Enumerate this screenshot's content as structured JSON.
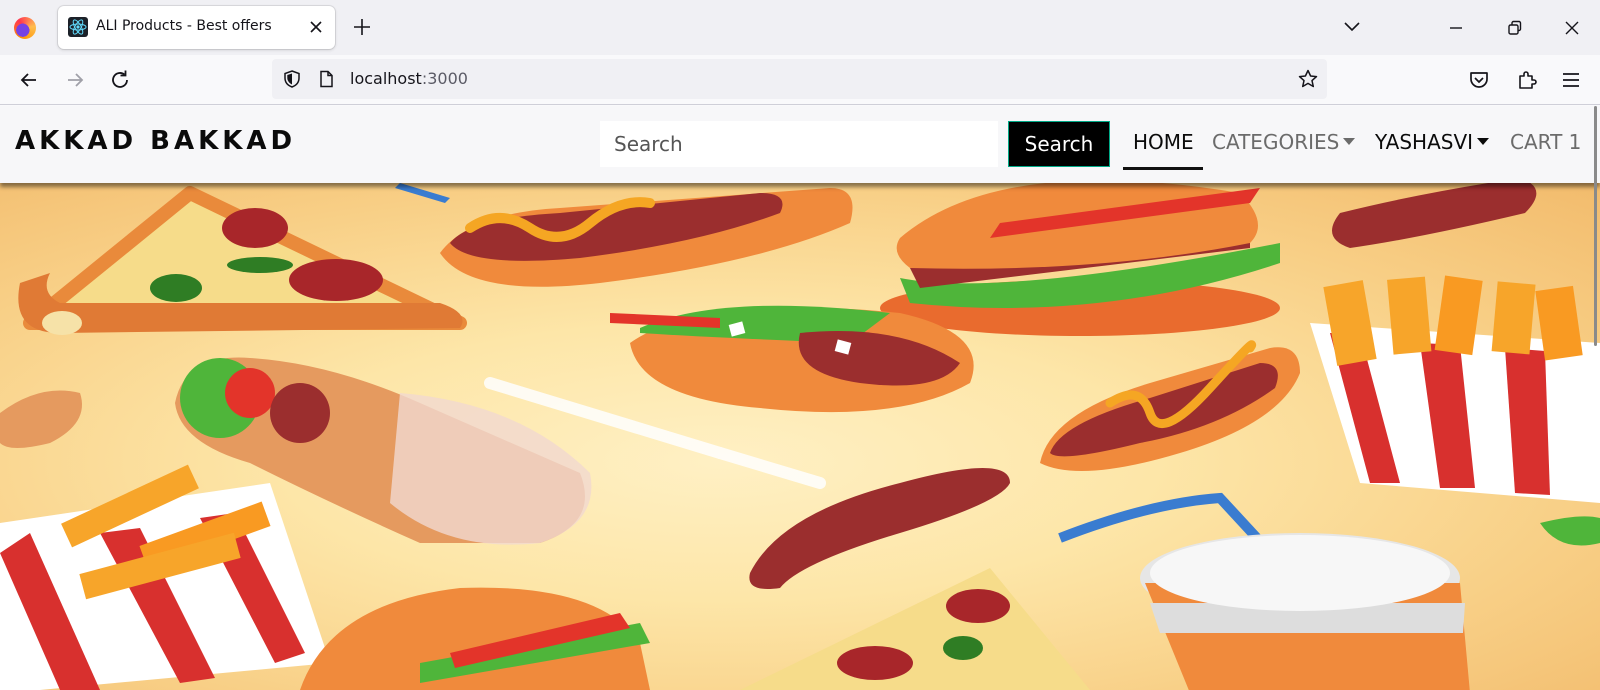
{
  "browser": {
    "tab_title": "ALI Products - Best offers",
    "url_host": "localhost",
    "url_port": ":3000"
  },
  "navbar": {
    "brand": "AKKAD BAKKAD",
    "search_placeholder": "Search",
    "search_button": "Search",
    "home": "HOME",
    "categories": "CATEGORIES",
    "user": "YASHASVI",
    "cart": "CART 1"
  },
  "hero": {
    "icon": "fast-food-banner",
    "colors": {
      "background": "#fde6a8",
      "bun": "#f08a3c",
      "sausage": "#9b2e2e",
      "mustard": "#f5a623",
      "lettuce": "#4fb53a",
      "stripe_red": "#d8302e"
    }
  }
}
